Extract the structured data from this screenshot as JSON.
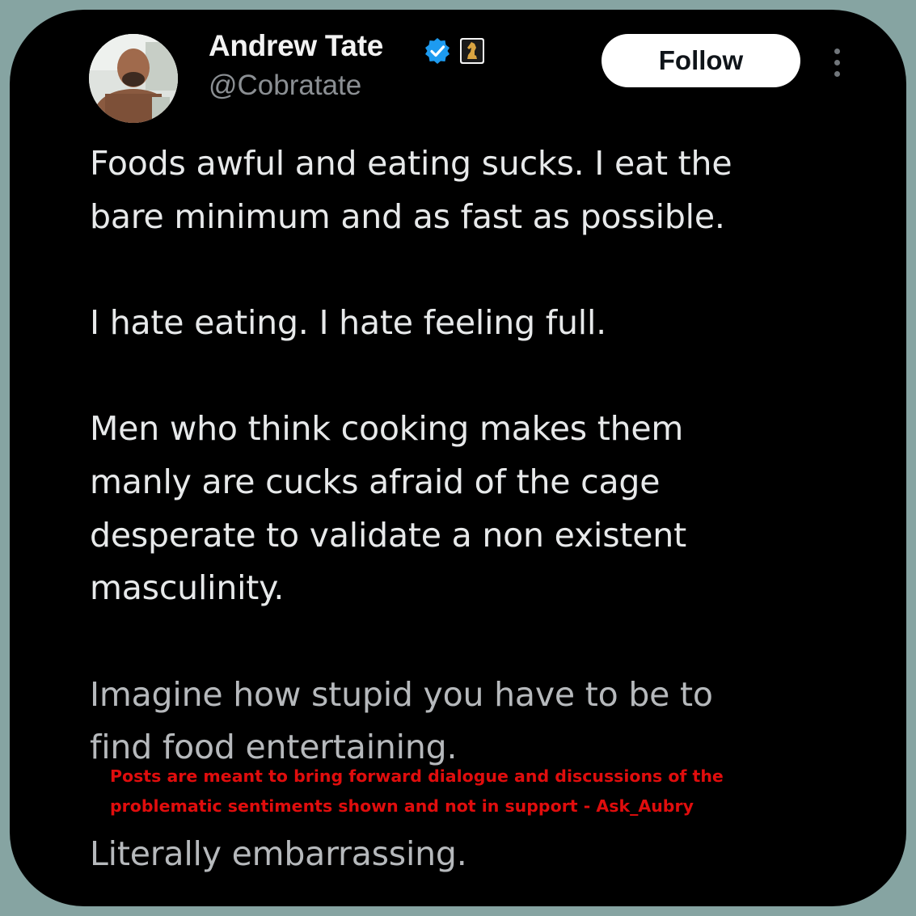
{
  "header": {
    "display_name": "Andrew Tate",
    "handle": "@Cobratate",
    "follow_label": "Follow"
  },
  "icons": {
    "verified": "verified-badge-icon",
    "affiliate": "chess-knight-affiliate-icon",
    "more": "more-options-icon"
  },
  "colors": {
    "background": "#000000",
    "outer_border": "#86a4a2",
    "verified_blue": "#1d9bf0",
    "watermark_red": "#e00d0d"
  },
  "post": {
    "lines": [
      "Foods awful and eating sucks. I eat the",
      "bare minimum and as fast as possible.",
      "I hate eating. I hate feeling full.",
      "Men who think cooking makes them",
      "manly are cucks afraid of the cage",
      "desperate to validate a non existent",
      "masculinity.",
      "Imagine how stupid you have to be to",
      "find food entertaining.",
      "Literally embarrassing."
    ]
  },
  "watermark": {
    "line1": "Posts are meant to bring forward dialogue and discussions of the",
    "line2": "problematic sentiments shown and not in support - Ask_Aubry"
  }
}
